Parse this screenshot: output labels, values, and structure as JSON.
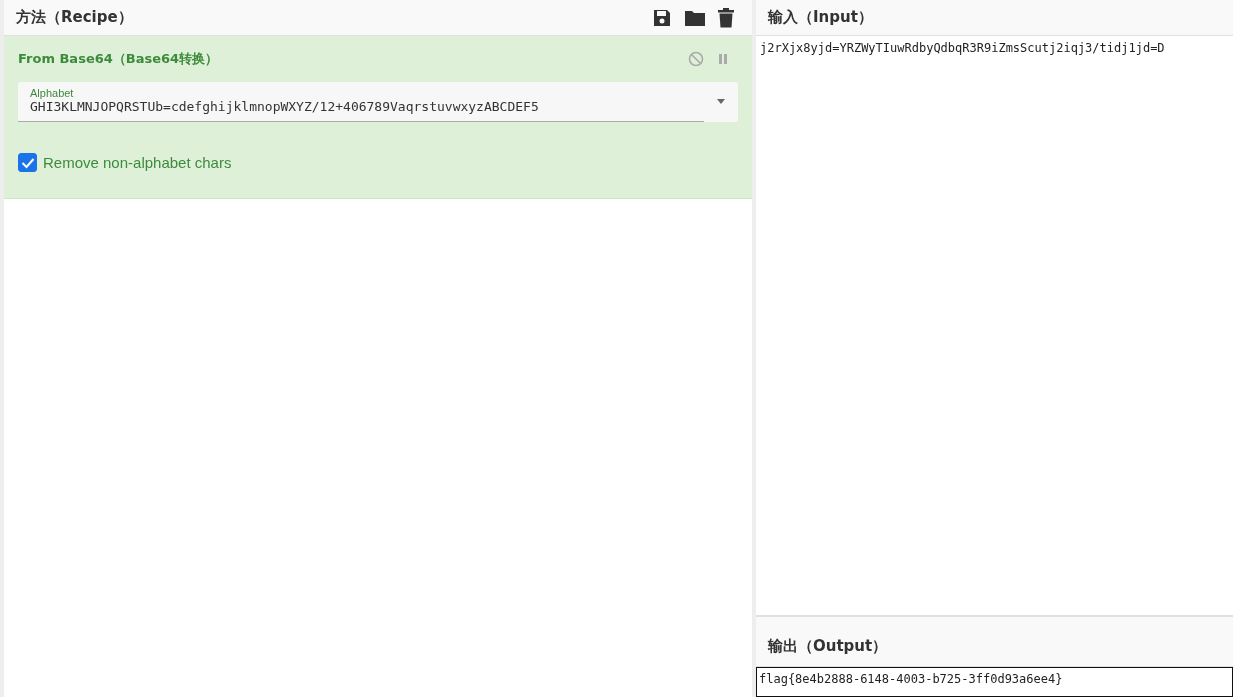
{
  "recipe": {
    "title": "方法（Recipe）",
    "operations": [
      {
        "name": "From Base64（Base64转换）",
        "fields": [
          {
            "kind": "dropdown",
            "label": "Alphabet",
            "value": "GHI3KLMNJOPQRSTUb=cdefghijklmnopWXYZ/12+406789VaqrstuvwxyzABCDEF5"
          },
          {
            "kind": "checkbox",
            "label": "Remove non-alphabet chars",
            "checked": true
          }
        ]
      }
    ]
  },
  "input": {
    "title": "输入（Input）",
    "value": "j2rXjx8yjd=YRZWyTIuwRdbyQdbqR3R9iZmsScutj2iqj3/tidj1jd=D"
  },
  "output": {
    "title": "输出（Output）",
    "value": "flag{8e4b2888-6148-4003-b725-3ff0d93a6ee4}"
  }
}
